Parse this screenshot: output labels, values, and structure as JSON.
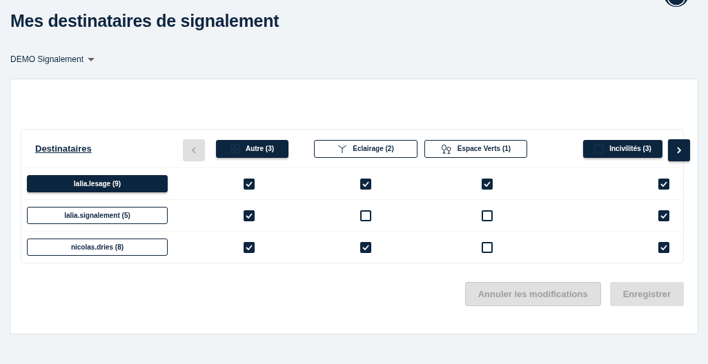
{
  "title": "Mes destinataires de signalement",
  "organization": {
    "label": "DEMO Signalement"
  },
  "table": {
    "heading": "Destinataires",
    "categories": [
      {
        "label": "Autre (3)",
        "selected": true
      },
      {
        "label": "Eclairage (2)",
        "selected": false
      },
      {
        "label": "Espace Verts (1)",
        "selected": false
      },
      {
        "label": "Incivilités (3)",
        "selected": true
      }
    ],
    "rows": [
      {
        "name": "lalia.lesage (9)",
        "selected": true,
        "checks": [
          true,
          true,
          true,
          true
        ]
      },
      {
        "name": "lalia.signalement (5)",
        "selected": false,
        "checks": [
          true,
          false,
          false,
          true
        ]
      },
      {
        "name": "nicolas.dries (8)",
        "selected": false,
        "checks": [
          true,
          true,
          false,
          true
        ]
      }
    ]
  },
  "actions": [
    {
      "label": "Annuler les modifications",
      "kind": "outline",
      "disabled": true
    },
    {
      "label": "Enregistrer",
      "kind": "solid",
      "disabled": true
    }
  ]
}
